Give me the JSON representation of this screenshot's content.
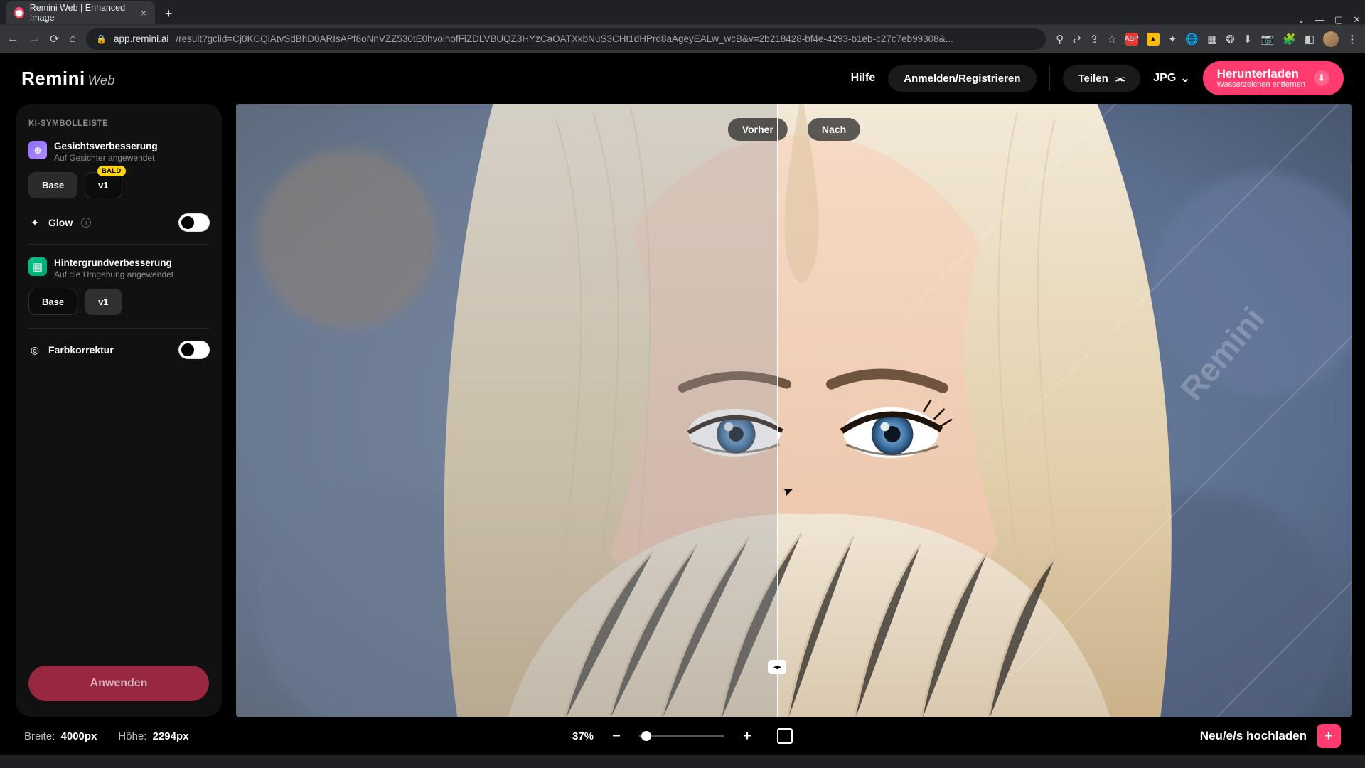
{
  "browser": {
    "tab_title": "Remini Web | Enhanced Image",
    "url_host": "app.remini.ai",
    "url_path": "/result?gclid=Cj0KCQiAtvSdBhD0ARIsAPf8oNnVZZ530tE0hvoinofFiZDLVBUQZ3HYzCaOATXkbNuS3CHt1dHPrd8aAgeyEALw_wcB&v=2b218428-bf4e-4293-b1eb-c27c7eb99308&..."
  },
  "logo": {
    "main": "Remini",
    "sub": "Web"
  },
  "header": {
    "help": "Hilfe",
    "login": "Anmelden/Registrieren",
    "share": "Teilen",
    "format": "JPG",
    "download": "Herunterladen",
    "download_sub": "Wasserzeichen entfernen"
  },
  "sidebar": {
    "heading": "KI-SYMBOLLEISTE",
    "face": {
      "title": "Gesichtsverbesserung",
      "sub": "Auf Gesichter angewendet"
    },
    "bg": {
      "title": "Hintergrundverbesserung",
      "sub": "Auf die Umgebung angewendet"
    },
    "chips": {
      "base": "Base",
      "v1": "v1",
      "badge": "BALD"
    },
    "glow": "Glow",
    "color": "Farbkorrektur",
    "apply": "Anwenden"
  },
  "viewer": {
    "before": "Vorher",
    "after": "Nach",
    "watermark": "Remini"
  },
  "footer": {
    "width_label": "Breite:",
    "width_val": "4000px",
    "height_label": "Höhe:",
    "height_val": "2294px",
    "zoom": "37%",
    "upload": "Neu/e/s hochladen"
  }
}
